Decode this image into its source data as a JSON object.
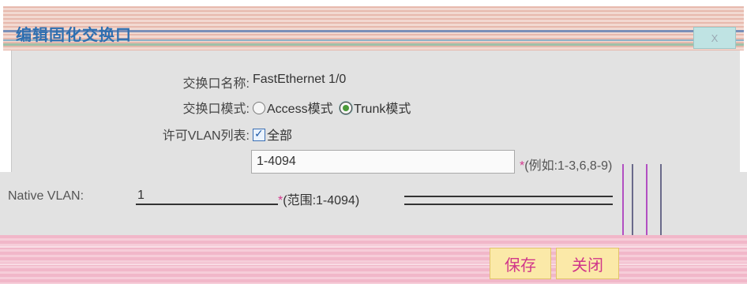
{
  "dialog": {
    "title": "编辑固化交换口",
    "close_label": "X"
  },
  "form": {
    "port_name_label": "交换口名称:",
    "port_name_value": "FastEthernet 1/0",
    "port_mode_label": "交换口模式:",
    "mode_access_label": "Access模式",
    "mode_trunk_label": "Trunk模式",
    "allowed_vlan_label": "许可VLAN列表:",
    "allowed_vlan_all_label": "全部",
    "allowed_vlan_value": "1-4094",
    "allowed_vlan_hint": "(例如:1-3,6,8-9)",
    "required_mark": "*",
    "native_vlan_label": "Native VLAN:",
    "native_vlan_value": "1",
    "native_vlan_hint": "(范围:1-4094)"
  },
  "footer": {
    "save_label": "保存",
    "close_label": "关闭"
  },
  "colors": {
    "title_text": "#2f6fb0",
    "button_text": "#d0368a",
    "button_bg": "#fbe9a8",
    "footer_band": "#f1b7c9",
    "panel_bg": "#e2e2e2"
  }
}
